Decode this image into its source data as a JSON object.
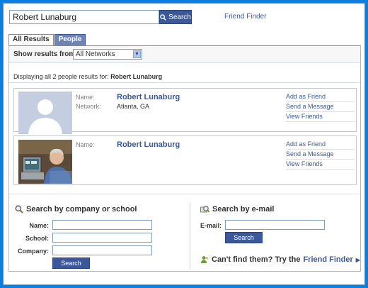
{
  "topbar": {
    "search_value": "Robert Lunaburg",
    "search_button": "Search",
    "friend_finder": "Friend Finder"
  },
  "tabs": [
    {
      "label": "All Results",
      "active": true
    },
    {
      "label": "People",
      "active": false
    }
  ],
  "filter": {
    "label": "Show results from",
    "selected": "All Networks"
  },
  "summary": {
    "prefix": "Displaying all 2 people results for:",
    "query": "Robert Lunaburg"
  },
  "results": [
    {
      "name_label": "Name:",
      "name": "Robert Lunaburg",
      "network_label": "Network:",
      "network": "Atlanta, GA",
      "actions": [
        "Add as Friend",
        "Send a Message",
        "View Friends"
      ]
    },
    {
      "name_label": "Name:",
      "name": "Robert Lunaburg",
      "actions": [
        "Add as Friend",
        "Send a Message",
        "View Friends"
      ]
    }
  ],
  "company_search": {
    "title": "Search by company or school",
    "name_label": "Name:",
    "school_label": "School:",
    "company_label": "Company:",
    "button": "Search"
  },
  "email_search": {
    "title": "Search by e-mail",
    "email_label": "E-mail:",
    "button": "Search"
  },
  "cant_find": {
    "prefix": "Can't find them? Try the",
    "link": "Friend Finder"
  },
  "colors": {
    "brand": "#3b5998",
    "background": "#0b7fe0"
  }
}
